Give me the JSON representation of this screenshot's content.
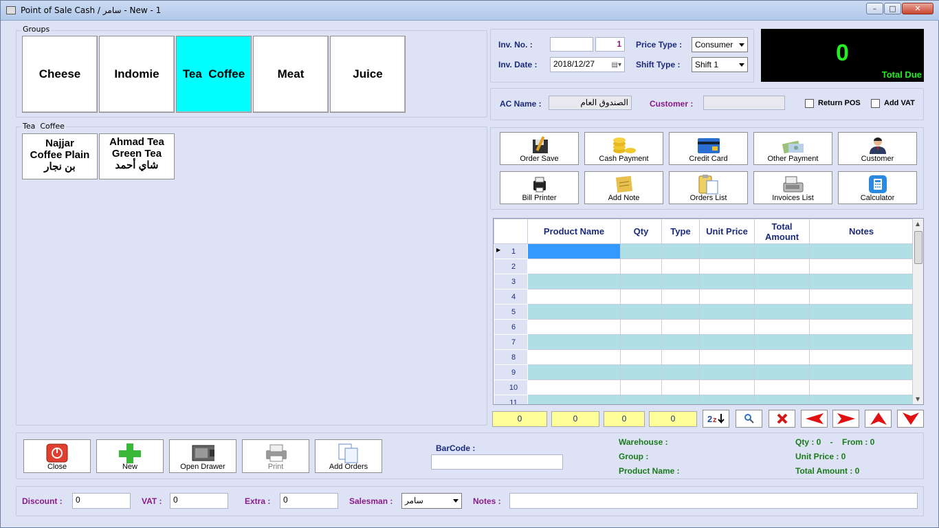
{
  "window": {
    "title": "Point of Sale Cash / سامر - New - 1",
    "min": "–",
    "max": "□",
    "close": "✕"
  },
  "groups": {
    "legend": "Groups",
    "items": [
      "Cheese",
      "Indomie",
      "Tea  Coffee",
      "Meat",
      "Juice"
    ],
    "selected": "Tea  Coffee"
  },
  "products": {
    "legend": "Tea  Coffee",
    "items": [
      {
        "line1": "Najjar",
        "line2": "Coffee Plain",
        "line3": "بن نجار"
      },
      {
        "line1": "Ahmad Tea",
        "line2": "Green Tea",
        "line3": "شاي أحمد"
      }
    ]
  },
  "invoice": {
    "inv_no_label": "Inv. No. :",
    "inv_no_prefix": "",
    "inv_no": "1",
    "inv_date_label": "Inv. Date :",
    "inv_date": "2018/12/27",
    "price_type_label": "Price Type :",
    "price_type": "Consumer",
    "shift_type_label": "Shift Type :",
    "shift_type": "Shift 1"
  },
  "total_due": {
    "value": "0",
    "caption": "Total Due"
  },
  "account": {
    "ac_name_label": "AC Name :",
    "ac_name": "الصندوق العام",
    "customer_label": "Customer :",
    "customer": "",
    "return_pos_label": "Return POS",
    "add_vat_label": "Add VAT"
  },
  "actions": [
    {
      "label": "Order Save",
      "icon": "order-save-icon"
    },
    {
      "label": "Cash Payment",
      "icon": "coins-icon"
    },
    {
      "label": "Credit Card",
      "icon": "credit-card-icon"
    },
    {
      "label": "Other Payment",
      "icon": "money-icon"
    },
    {
      "label": "Customer",
      "icon": "person-icon"
    },
    {
      "label": "Bill Printer",
      "icon": "printer-icon"
    },
    {
      "label": "Add Note",
      "icon": "note-icon"
    },
    {
      "label": "Orders List",
      "icon": "clipboard-icon"
    },
    {
      "label": "Invoices List",
      "icon": "cash-register-icon"
    },
    {
      "label": "Calculator",
      "icon": "calculator-icon"
    }
  ],
  "grid": {
    "columns": [
      "Product Name",
      "Qty",
      "Type",
      "Unit Price",
      "Total Amount",
      "Notes"
    ],
    "row_numbers": [
      "1",
      "2",
      "3",
      "4",
      "5",
      "6",
      "7",
      "8",
      "9",
      "10",
      "11"
    ],
    "current_row": "1"
  },
  "totals": {
    "qty": "0",
    "unit": "0",
    "type": "0",
    "amount": "0"
  },
  "nav_icons": [
    "sort-icon",
    "search-icon",
    "delete-icon",
    "first-icon",
    "last-icon",
    "up-icon",
    "down-icon"
  ],
  "bottom_buttons": [
    {
      "label": "Close",
      "icon": "power-icon",
      "disabled": false
    },
    {
      "label": "New",
      "icon": "plus-icon",
      "disabled": false
    },
    {
      "label": "Open Drawer",
      "icon": "drawer-icon",
      "disabled": false
    },
    {
      "label": "Print",
      "icon": "printer-icon",
      "disabled": true
    },
    {
      "label": "Add Orders",
      "icon": "documents-icon",
      "disabled": false
    }
  ],
  "barcode": {
    "label": "BarCode :",
    "value": ""
  },
  "item_info": {
    "warehouse": "Warehouse :",
    "group": "Group :",
    "product_name": "Product Name :",
    "qty_from": "Qty : 0    -    From : 0",
    "unit_price": "Unit Price : 0",
    "total_amount": "Total Amount : 0"
  },
  "footer": {
    "discount_label": "Discount :",
    "discount": "0",
    "vat_label": "VAT :",
    "vat": "0",
    "extra_label": "Extra :",
    "extra": "0",
    "salesman_label": "Salesman :",
    "salesman": "سامر",
    "notes_label": "Notes :",
    "notes": ""
  },
  "colors": {
    "accent_cyan": "#00ffff",
    "grid_row": "#b0dfe5",
    "total_due_bg": "#000000",
    "total_due_fg": "#22ee22",
    "label_blue": "#1b2a7a",
    "label_purple": "#8a1a8a",
    "label_green": "#1a7a1a"
  }
}
